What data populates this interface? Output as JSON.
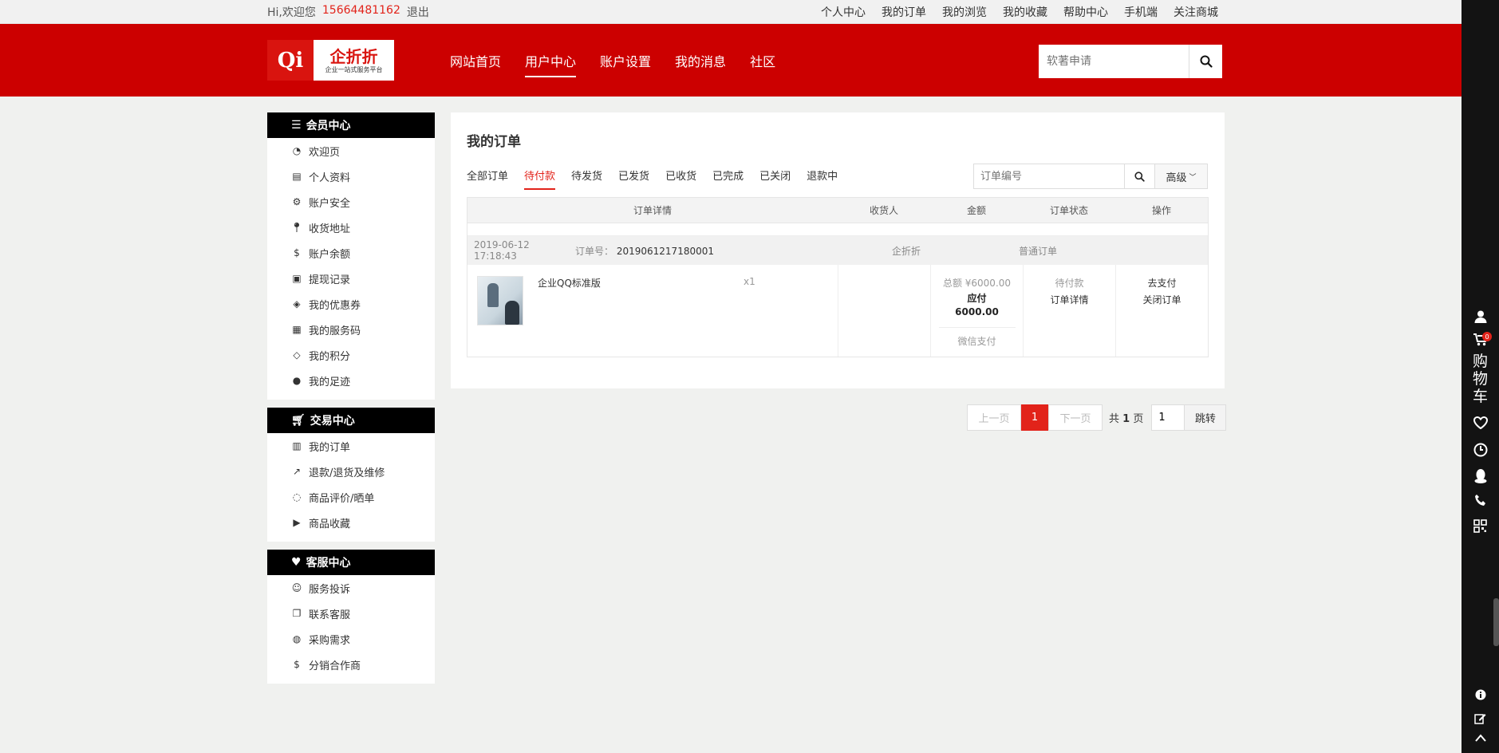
{
  "topbar": {
    "greeting": "Hi,欢迎您",
    "phone": "15664481162",
    "logout": "退出",
    "links": [
      "个人中心",
      "我的订单",
      "我的浏览",
      "我的收藏",
      "帮助中心",
      "手机端",
      "关注商城"
    ]
  },
  "header": {
    "logo_qi": "Qi",
    "logo_brand": "企折折",
    "logo_slogan": "企业一站式服务平台",
    "nav": [
      {
        "label": "网站首页",
        "active": false
      },
      {
        "label": "用户中心",
        "active": true
      },
      {
        "label": "账户设置",
        "active": false
      },
      {
        "label": "我的消息",
        "active": false
      },
      {
        "label": "社区",
        "active": false
      }
    ],
    "search_placeholder": "软著申请"
  },
  "sidebar": {
    "groups": [
      {
        "title": "会员中心",
        "icon": "list-icon",
        "items": [
          {
            "label": "欢迎页",
            "icon": "dashboard-icon"
          },
          {
            "label": "个人资料",
            "icon": "id-card-icon"
          },
          {
            "label": "账户安全",
            "icon": "gear-icon"
          },
          {
            "label": "收货地址",
            "icon": "map-pin-icon"
          },
          {
            "label": "账户余额",
            "icon": "dollar-icon"
          },
          {
            "label": "提现记录",
            "icon": "money-icon"
          },
          {
            "label": "我的优惠券",
            "icon": "tag-icon"
          },
          {
            "label": "我的服务码",
            "icon": "calendar-icon"
          },
          {
            "label": "我的积分",
            "icon": "diamond-icon"
          },
          {
            "label": "我的足迹",
            "icon": "check-circle-icon"
          }
        ]
      },
      {
        "title": "交易中心",
        "icon": "cart-icon",
        "items": [
          {
            "label": "我的订单",
            "icon": "bag-icon"
          },
          {
            "label": "退款/退货及维修",
            "icon": "share-icon"
          },
          {
            "label": "商品评价/晒单",
            "icon": "comment-icon"
          },
          {
            "label": "商品收藏",
            "icon": "play-circle-icon"
          }
        ]
      },
      {
        "title": "客服中心",
        "icon": "heart-icon",
        "items": [
          {
            "label": "服务投诉",
            "icon": "user-circle-icon"
          },
          {
            "label": "联系客服",
            "icon": "clone-icon"
          },
          {
            "label": "采购需求",
            "icon": "comments-icon"
          },
          {
            "label": "分销合作商",
            "icon": "dollar-icon"
          }
        ]
      }
    ]
  },
  "main": {
    "title": "我的订单",
    "tabs": [
      {
        "label": "全部订单",
        "active": false
      },
      {
        "label": "待付款",
        "active": true
      },
      {
        "label": "待发货",
        "active": false
      },
      {
        "label": "已发货",
        "active": false
      },
      {
        "label": "已收货",
        "active": false
      },
      {
        "label": "已完成",
        "active": false
      },
      {
        "label": "已关闭",
        "active": false
      },
      {
        "label": "退款中",
        "active": false
      }
    ],
    "order_search_placeholder": "订单编号",
    "advanced_label": "高级",
    "columns": [
      "订单详情",
      "收货人",
      "金额",
      "订单状态",
      "操作"
    ],
    "order": {
      "time": "2019-06-12 17:18:43",
      "no_label": "订单号：",
      "no": "2019061217180001",
      "shop": "企折折",
      "type": "普通订单",
      "goods_name": "企业QQ标准版",
      "qty": "x1",
      "total": "总额 ¥6000.00",
      "pay_label": "应付",
      "pay_value": "6000.00",
      "pay_method": "微信支付",
      "status": "待付款",
      "detail_link": "订单详情",
      "action_pay": "去支付",
      "action_close": "关闭订单"
    }
  },
  "pager": {
    "prev": "上一页",
    "current": "1",
    "next": "下一页",
    "total_prefix": "共",
    "total_pages": "1",
    "total_suffix": "页",
    "jump_value": "1",
    "jump_label": "跳转"
  },
  "rail": {
    "cart_word": "购物车",
    "cart_count": "0",
    "icons": [
      "user-icon",
      "cart-icon",
      "heart-icon",
      "clock-icon",
      "qq-icon",
      "phone-icon",
      "qrcode-icon",
      "info-icon",
      "edit-icon",
      "arrow-up-icon"
    ]
  },
  "colors": {
    "brand_red": "#cc0000",
    "accent_red": "#e2231a",
    "rail_black": "#131313"
  }
}
